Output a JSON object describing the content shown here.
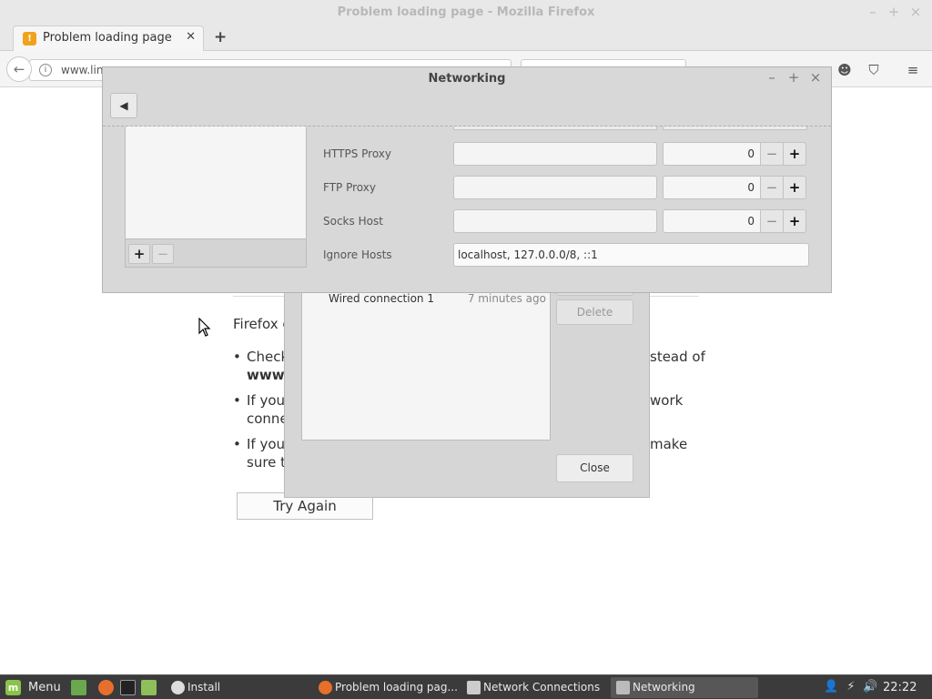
{
  "firefox": {
    "window_title": "Problem loading page - Mozilla Firefox",
    "tab_title": "Problem loading page",
    "url_text": "www.lin",
    "content": {
      "intro": "Firefox c",
      "bullets": [
        {
          "left": "Check",
          "left_bold": "www.",
          "right": "stead of"
        },
        {
          "left": "If you",
          "left2": "conne",
          "right": "work"
        },
        {
          "left": "If you",
          "left2": "sure t",
          "right": "make"
        }
      ],
      "try_again": "Try Again"
    }
  },
  "networking_dialog": {
    "title": "Networking",
    "rows": [
      {
        "label": "HTTPS Proxy",
        "value": "",
        "port": "0"
      },
      {
        "label": "FTP Proxy",
        "value": "",
        "port": "0"
      },
      {
        "label": "Socks Host",
        "value": "",
        "port": "0"
      }
    ],
    "ignore_hosts": {
      "label": "Ignore Hosts",
      "value": "localhost, 127.0.0.0/8, ::1"
    },
    "list_add": "+",
    "list_remove": "−"
  },
  "network_connections_dialog": {
    "connection": {
      "name": "Wired connection 1",
      "time": "7 minutes ago"
    },
    "delete_button": "Delete",
    "close_button": "Close"
  },
  "taskbar": {
    "menu_label": "Menu",
    "windows": [
      {
        "label": "Install"
      },
      {
        "label": "Problem loading pag..."
      },
      {
        "label": "Network Connections"
      },
      {
        "label": "Networking"
      }
    ],
    "clock": "22:22"
  }
}
